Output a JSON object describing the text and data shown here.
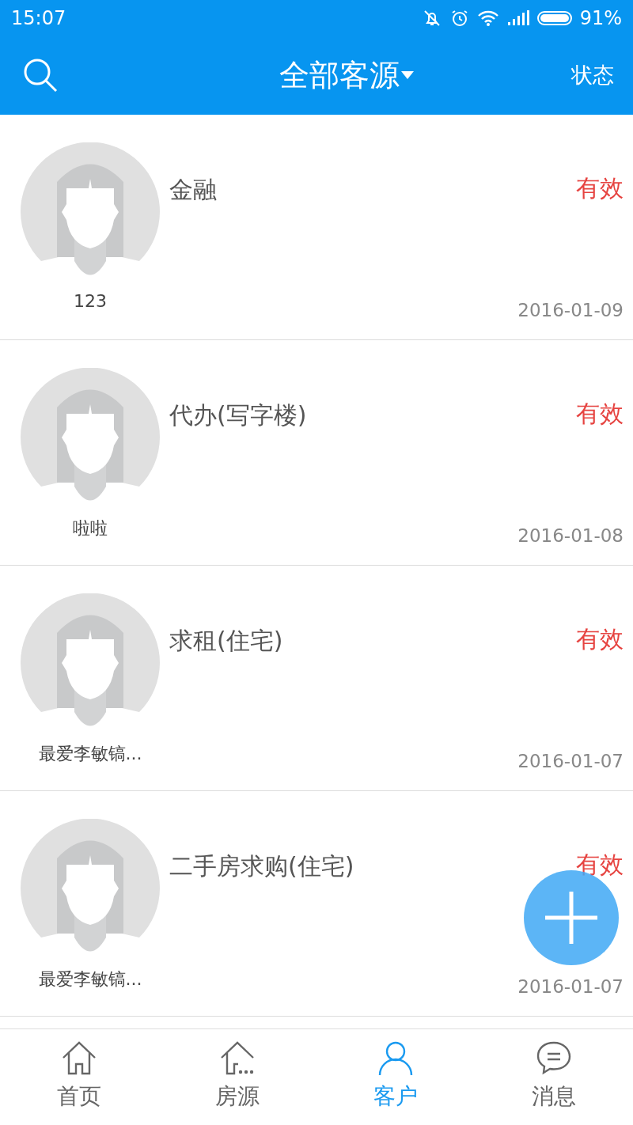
{
  "status_bar": {
    "time": "15:07",
    "battery": "91%"
  },
  "header": {
    "title": "全部客源",
    "action": "状态"
  },
  "customers": [
    {
      "name": "123",
      "demand": "金融",
      "status": "有效",
      "date": "2016-01-09"
    },
    {
      "name": "啦啦",
      "demand": "代办(写字楼)",
      "status": "有效",
      "date": "2016-01-08"
    },
    {
      "name": "最爱李敏镐...",
      "demand": "求租(住宅)",
      "status": "有效",
      "date": "2016-01-07"
    },
    {
      "name": "最爱李敏镐...",
      "demand": "二手房求购(住宅)",
      "status": "有效",
      "date": "2016-01-07"
    }
  ],
  "tabs": [
    {
      "label": "首页",
      "kind": "home",
      "selected": false
    },
    {
      "label": "房源",
      "kind": "listings",
      "selected": false
    },
    {
      "label": "客户",
      "kind": "client",
      "selected": true
    },
    {
      "label": "消息",
      "kind": "message",
      "selected": false
    }
  ]
}
